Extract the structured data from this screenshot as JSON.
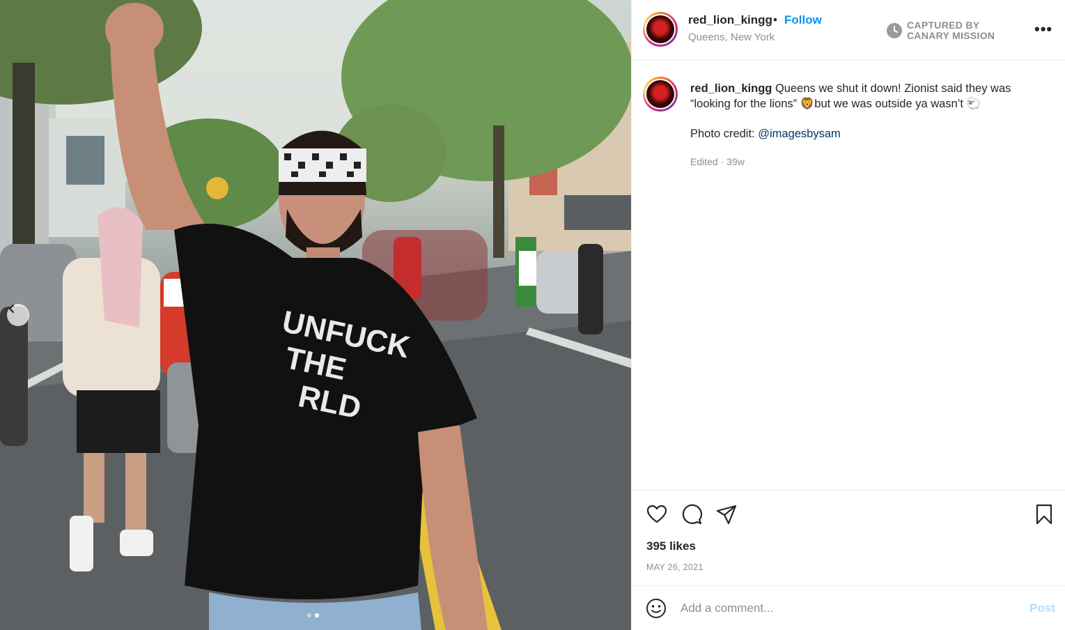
{
  "post": {
    "username": "red_lion_kingg",
    "separator": "•",
    "follow_label": "Follow",
    "location": "Queens, New York",
    "watermark": {
      "line1": "CAPTURED BY",
      "line2": "CANARY MISSION"
    },
    "more_label": "•••",
    "shirt_text": {
      "line1": "UNFUCK",
      "line2": "THE",
      "line3": "RLD"
    }
  },
  "caption": {
    "username": "red_lion_kingg",
    "text": "Queens we shut it down! Zionist said they was “looking for the lions” 🦁but we was outside ya wasn’t 🐑",
    "credit_prefix": "Photo credit: ",
    "credit_mention": "@imagesbysam",
    "edited": "Edited · 39w"
  },
  "stats": {
    "likes": "395 likes",
    "date": "MAY 26, 2021"
  },
  "comment": {
    "placeholder": "Add a comment...",
    "post_label": "Post"
  },
  "carousel": {
    "current_index": 2,
    "total": 2
  },
  "colors": {
    "accent": "#0095f6",
    "muted": "#8e8e8e",
    "link": "#00376b",
    "post_disabled": "#b2dffc"
  },
  "icons": [
    "heart-icon",
    "comment-icon",
    "share-icon",
    "bookmark-icon",
    "emoji-icon",
    "clock-icon",
    "chevron-left-icon"
  ]
}
